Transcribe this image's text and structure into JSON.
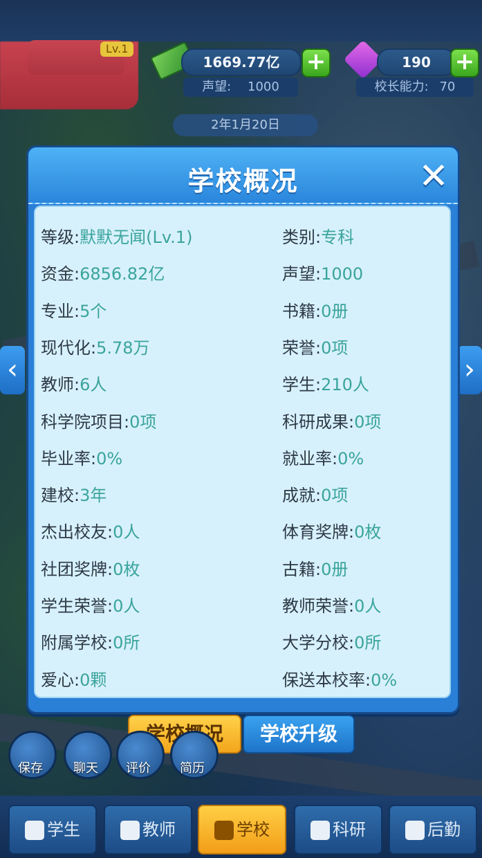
{
  "top": {
    "level_tag": "Lv.1",
    "money": "1669.77亿",
    "reputation_label": "声望:",
    "reputation_value": "1000",
    "gems": "190",
    "principal_label": "校长能力:",
    "principal_value": "70",
    "date": "2年1月20日"
  },
  "modal": {
    "title": "学校概况",
    "close_icon": "close-icon",
    "stats_left": [
      {
        "label": "等级:",
        "value": "默默无闻(Lv.1)"
      },
      {
        "label": "资金:",
        "value": "6856.82亿"
      },
      {
        "label": "专业:",
        "value": "5个"
      },
      {
        "label": "现代化:",
        "value": "5.78万"
      },
      {
        "label": "教师:",
        "value": "6人"
      },
      {
        "label": "科学院项目:",
        "value": "0项"
      },
      {
        "label": "毕业率:",
        "value": "0%"
      },
      {
        "label": "建校:",
        "value": "3年"
      },
      {
        "label": "杰出校友:",
        "value": "0人"
      },
      {
        "label": "社团奖牌:",
        "value": "0枚"
      },
      {
        "label": "学生荣誉:",
        "value": "0人"
      },
      {
        "label": "附属学校:",
        "value": "0所"
      },
      {
        "label": "爱心:",
        "value": "0颗"
      }
    ],
    "stats_right": [
      {
        "label": "类别:",
        "value": "专科"
      },
      {
        "label": "声望:",
        "value": "1000"
      },
      {
        "label": "书籍:",
        "value": "0册"
      },
      {
        "label": "荣誉:",
        "value": "0项"
      },
      {
        "label": "学生:",
        "value": "210人"
      },
      {
        "label": "科研成果:",
        "value": "0项"
      },
      {
        "label": "就业率:",
        "value": "0%"
      },
      {
        "label": "成就:",
        "value": "0项"
      },
      {
        "label": "体育奖牌:",
        "value": "0枚"
      },
      {
        "label": "古籍:",
        "value": "0册"
      },
      {
        "label": "教师荣誉:",
        "value": "0人"
      },
      {
        "label": "大学分校:",
        "value": "0所"
      },
      {
        "label": "保送本校率:",
        "value": "0%"
      }
    ]
  },
  "tabs": {
    "overview": "学校概况",
    "upgrade": "学校升级"
  },
  "actions": [
    {
      "label": "保存",
      "icon": "save-icon"
    },
    {
      "label": "聊天",
      "icon": "chat-icon"
    },
    {
      "label": "评价",
      "icon": "rating-icon"
    },
    {
      "label": "简历",
      "icon": "resume-icon"
    }
  ],
  "nav": [
    {
      "label": "学生",
      "icon": "student-icon"
    },
    {
      "label": "教师",
      "icon": "teacher-icon"
    },
    {
      "label": "学校",
      "icon": "school-icon"
    },
    {
      "label": "科研",
      "icon": "research-icon"
    },
    {
      "label": "后勤",
      "icon": "logistics-icon"
    }
  ],
  "colors": {
    "accent_value": "#3aa49c",
    "modal_blue": "#2a7fd6",
    "active_tab": "#f2a51b"
  }
}
